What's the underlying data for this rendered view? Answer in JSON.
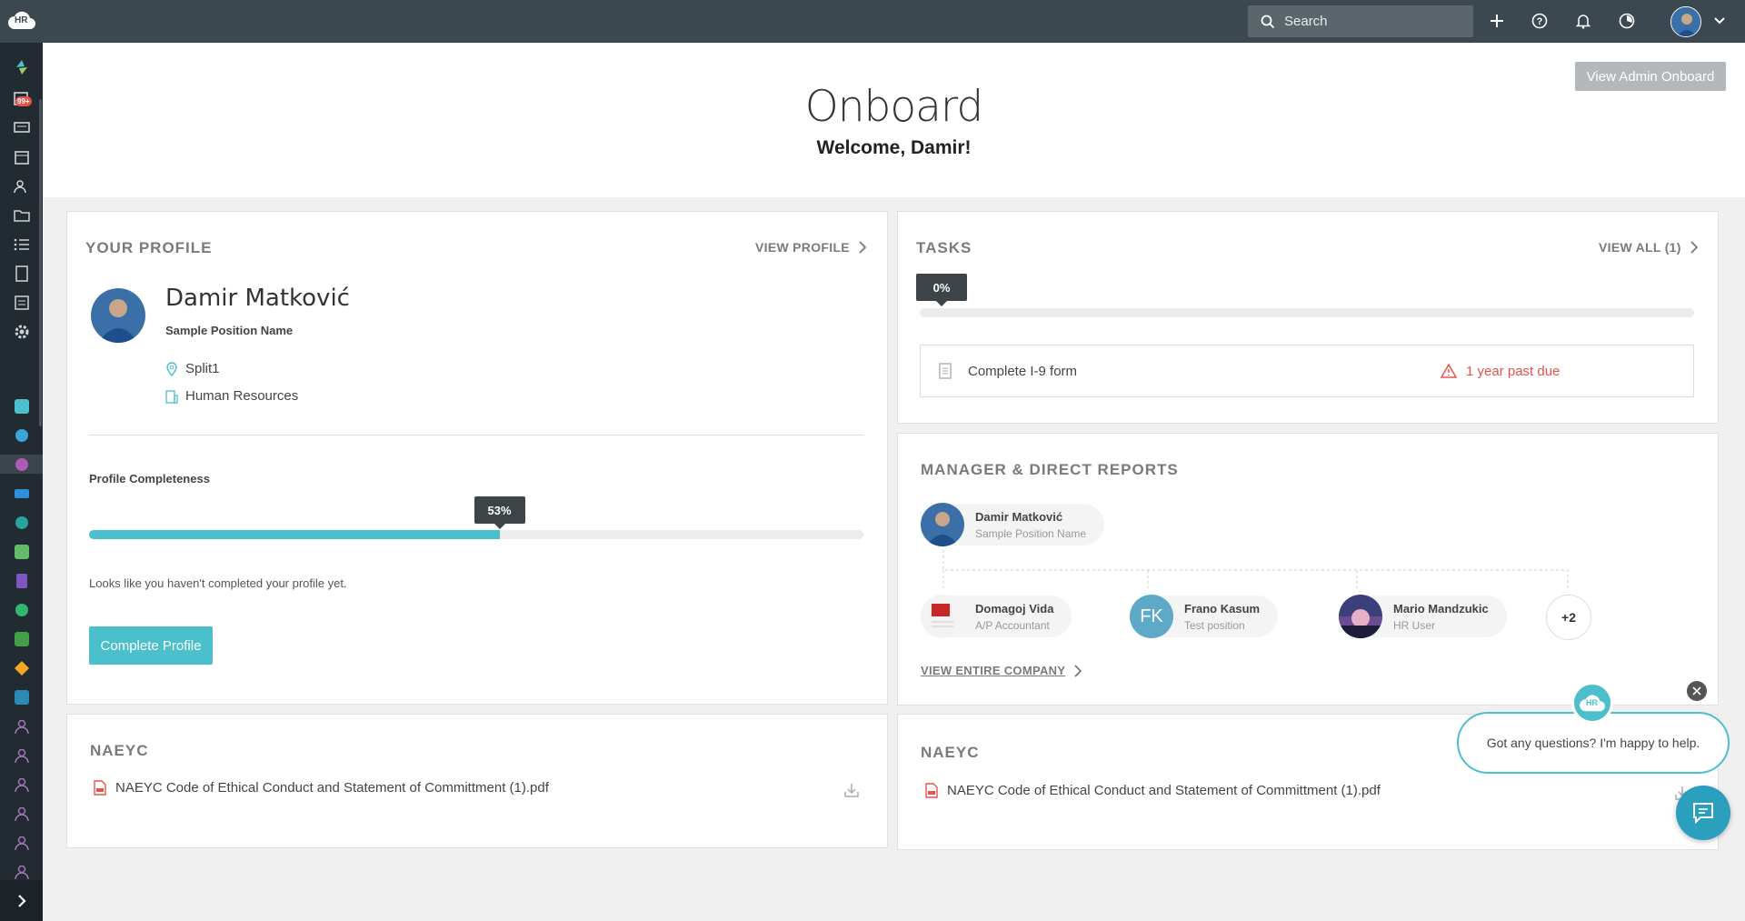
{
  "topbar": {
    "logo_text": "HR",
    "search_placeholder": "Search"
  },
  "header": {
    "title": "Onboard",
    "welcome": "Welcome, Damir!",
    "admin_button": "View Admin Onboard"
  },
  "profile": {
    "section_title": "YOUR PROFILE",
    "view_link": "VIEW PROFILE",
    "name": "Damir Matković",
    "position": "Sample Position Name",
    "location": "Split1",
    "department": "Human Resources",
    "completeness_label": "Profile Completeness",
    "completeness_percent": 53,
    "completeness_text": "53%",
    "message": "Looks like you haven't completed your profile yet.",
    "complete_button": "Complete Profile"
  },
  "tasks": {
    "section_title": "TASKS",
    "view_all": "VIEW ALL (1)",
    "progress_percent": 0,
    "progress_text": "0%",
    "items": [
      {
        "label": "Complete I-9 form",
        "status": "1 year past due"
      }
    ]
  },
  "manager": {
    "section_title": "MANAGER & DIRECT REPORTS",
    "manager": {
      "name": "Damir Matković",
      "position": "Sample Position Name"
    },
    "reports": [
      {
        "name": "Domagoj Vida",
        "position": "A/P Accountant"
      },
      {
        "name": "Frano Kasum",
        "position": "Test position",
        "initials": "FK"
      },
      {
        "name": "Mario Mandzukic",
        "position": "HR User"
      }
    ],
    "more_count": "+2",
    "view_company": "VIEW ENTIRE COMPANY"
  },
  "naeyc_left": {
    "section_title": "NAEYC",
    "file": "NAEYC Code of Ethical Conduct and Statement of Committment (1).pdf"
  },
  "naeyc_right": {
    "section_title": "NAEYC",
    "file": "NAEYC Code of Ethical Conduct and Statement of Committment (1).pdf"
  },
  "chat": {
    "logo_text": "HR",
    "message": "Got any questions? I'm happy to help."
  },
  "sidebar_badge": "99+",
  "colors": {
    "accent": "#4bbfcb",
    "topbar": "#3c4850",
    "sidebar": "#222b31",
    "danger": "#e5534b"
  }
}
